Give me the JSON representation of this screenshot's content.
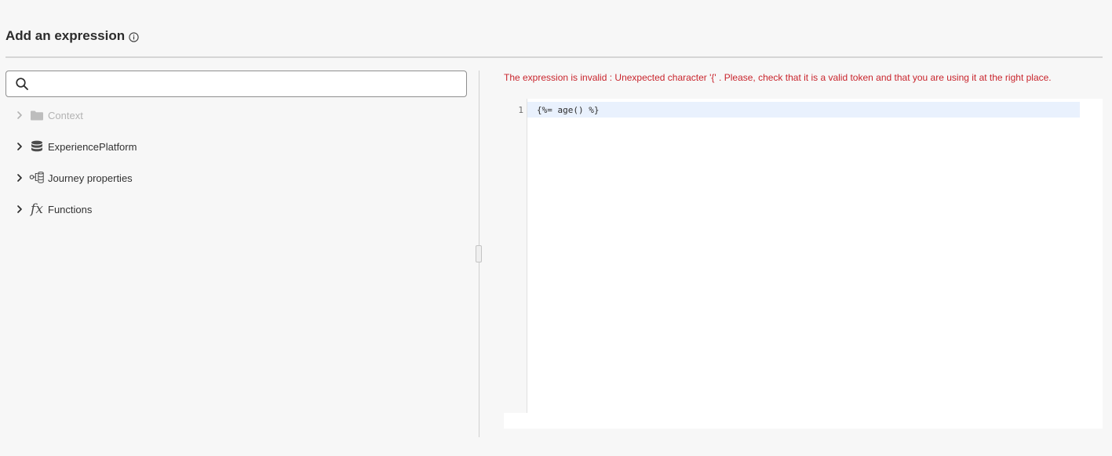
{
  "header": {
    "title": "Add an expression",
    "info_icon": "info-icon"
  },
  "search": {
    "value": "",
    "placeholder": "",
    "icon": "search-icon"
  },
  "tree": {
    "items": [
      {
        "label": "Context",
        "icon": "folder-icon",
        "state": "collapsed",
        "enabled": false
      },
      {
        "label": "ExperiencePlatform",
        "icon": "database-icon",
        "state": "collapsed",
        "enabled": true
      },
      {
        "label": "Journey properties",
        "icon": "journey-properties-icon",
        "state": "collapsed",
        "enabled": true
      },
      {
        "label": "Functions",
        "icon": "fx-icon",
        "glyph": "fx",
        "state": "collapsed",
        "enabled": true
      }
    ]
  },
  "editor": {
    "error": "The expression is invalid : Unexpected character '{' . Please, check that it is a valid token and that you are using it at the right place.",
    "line_numbers": [
      "1"
    ],
    "lines": [
      "{%= age() %}"
    ]
  },
  "colors": {
    "error": "#c9252d",
    "active_line": "#e9f1fd",
    "background": "#f7f7f7"
  }
}
